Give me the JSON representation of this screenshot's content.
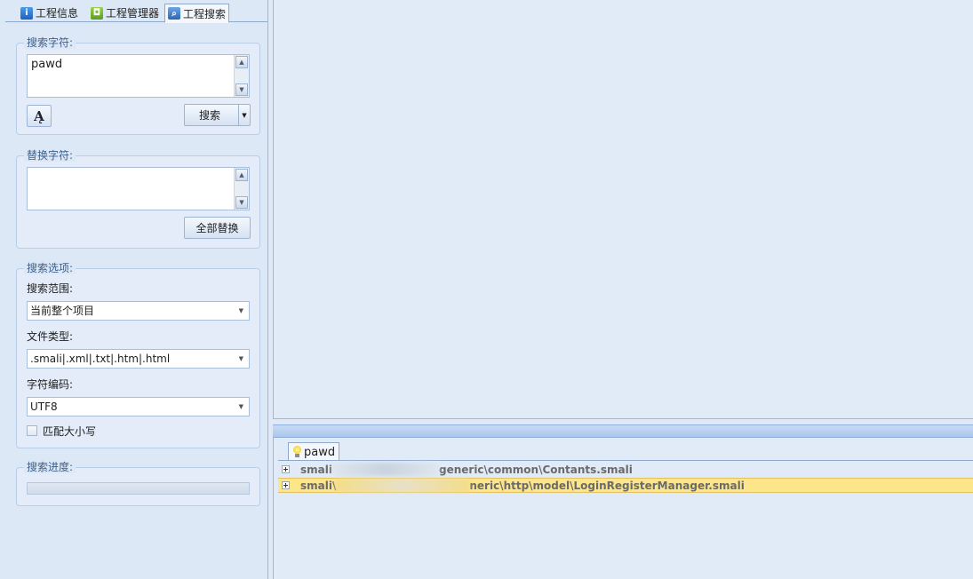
{
  "tabs": [
    {
      "label": "工程信息",
      "icon": "info-icon"
    },
    {
      "label": "工程管理器",
      "icon": "android-icon"
    },
    {
      "label": "工程搜索",
      "icon": "search-icon"
    }
  ],
  "search_group": {
    "title": "搜索字符:",
    "value": "pawd",
    "search_button": "搜索"
  },
  "replace_group": {
    "title": "替换字符:",
    "value": "",
    "replace_all_button": "全部替换"
  },
  "options_group": {
    "title": "搜索选项:",
    "scope_label": "搜索范围:",
    "scope_value": "当前整个项目",
    "filetype_label": "文件类型:",
    "filetype_value": ".smali|.xml|.txt|.htm|.html",
    "encoding_label": "字符编码:",
    "encoding_value": "UTF8",
    "match_case_label": "匹配大小写",
    "match_case_checked": false
  },
  "progress_group": {
    "title": "搜索进度:",
    "progress": 0
  },
  "results": {
    "tab_label": "pawd",
    "rows": [
      {
        "prefix": "smali",
        "suffix": "generic\\common\\Contants.smali",
        "selected": false
      },
      {
        "prefix": "smali\\",
        "suffix": "neric\\http\\model\\LoginRegisterManager.smali",
        "selected": true
      }
    ]
  }
}
